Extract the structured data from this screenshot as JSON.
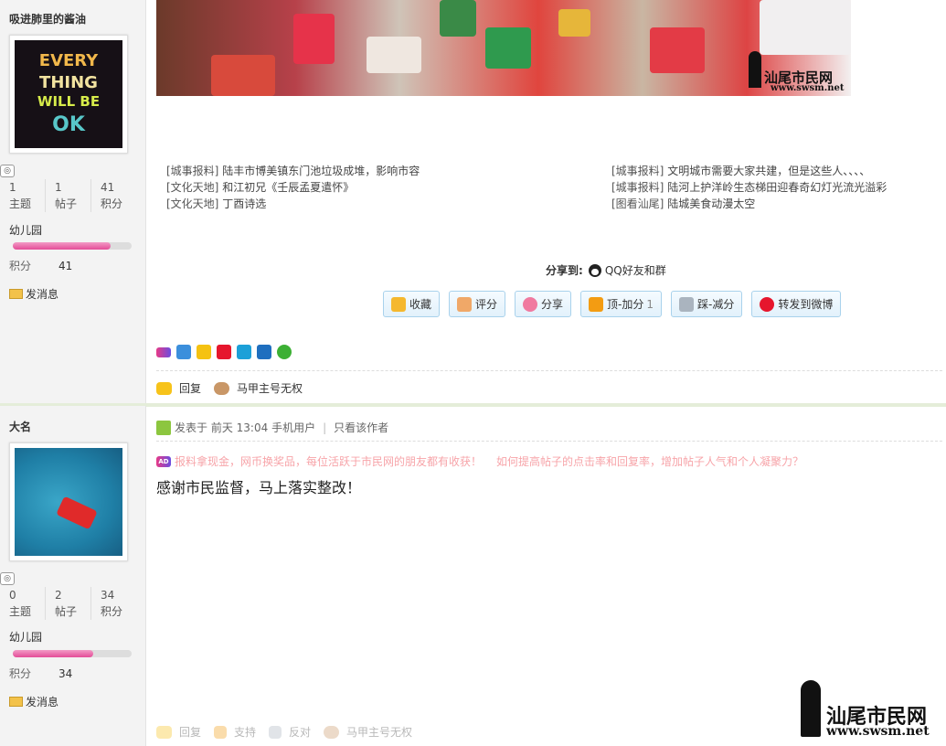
{
  "posts": [
    {
      "author": "吸进肺里的酱油",
      "avatar_text": [
        "EVERY",
        "THING",
        "WILL BE",
        "OK"
      ],
      "stats": [
        {
          "value": "1",
          "label": "主题"
        },
        {
          "value": "1",
          "label": "帖子"
        },
        {
          "value": "41",
          "label": "积分"
        }
      ],
      "level": "幼儿园",
      "level_progress": 0.82,
      "points_label": "积分",
      "points_value": "41",
      "message_label": "发消息"
    },
    {
      "author": "大名",
      "stats": [
        {
          "value": "0",
          "label": "主题"
        },
        {
          "value": "2",
          "label": "帖子"
        },
        {
          "value": "34",
          "label": "积分"
        }
      ],
      "level": "幼儿园",
      "level_progress": 0.68,
      "points_label": "积分",
      "points_value": "34",
      "message_label": "发消息"
    }
  ],
  "banner": {
    "watermark_cn": "汕尾市民网",
    "watermark_url": "www.swsm.net"
  },
  "related_links": {
    "left": [
      {
        "cat": "[城事报料]",
        "title": "陆丰市博美镇东门池垃圾成堆，影响市容"
      },
      {
        "cat": "[文化天地]",
        "title": "和江初兄《壬辰孟夏遣怀》"
      },
      {
        "cat": "[文化天地]",
        "title": "丁酉诗选"
      }
    ],
    "right": [
      {
        "cat": "[城事报料]",
        "title": "文明城市需要大家共建，但是这些人、、、、"
      },
      {
        "cat": "[城事报料]",
        "title": "陆河上护洋岭生态梯田迎春奇幻灯光流光溢彩"
      },
      {
        "cat": "[图看汕尾]",
        "title": "陆城美食动漫太空"
      }
    ]
  },
  "share": {
    "label": "分享到:",
    "target": "QQ好友和群"
  },
  "actions": [
    {
      "label": "收藏",
      "icon": "star-icon",
      "color": "#f5b82e"
    },
    {
      "label": "评分",
      "icon": "thumb-icon",
      "color": "#f0a868"
    },
    {
      "label": "分享",
      "icon": "heart-icon",
      "color": "#f07aa0"
    },
    {
      "label": "顶-加分",
      "count": "1",
      "icon": "arrow-up-icon",
      "color": "#f39c12"
    },
    {
      "label": "踩-减分",
      "icon": "arrow-down-icon",
      "color": "#aab4bf"
    },
    {
      "label": "转发到微博",
      "icon": "weibo-icon",
      "color": "#e6162d"
    }
  ],
  "share_icons": [
    {
      "name": "ad-icon",
      "color": "#7b4ce0"
    },
    {
      "name": "plus-share-icon",
      "color": "#3b8fdc"
    },
    {
      "name": "qzone-icon",
      "color": "#f5c211"
    },
    {
      "name": "weibo-share-icon",
      "color": "#e6162d"
    },
    {
      "name": "tencent-weibo-icon",
      "color": "#1ca0d8"
    },
    {
      "name": "renren-icon",
      "color": "#1f6fbf"
    },
    {
      "name": "wechat-icon",
      "color": "#3cb034"
    }
  ],
  "reply_bar": {
    "reply": "回复",
    "sockpuppet": "马甲主号无权"
  },
  "post2": {
    "posted_prefix": "发表于",
    "posted_time": "前天 13:04",
    "device": "手机用户",
    "only_author": "只看该作者",
    "ad1": "报料拿现金，网币换奖品，每位活跃于市民网的朋友都有收获！",
    "ad2": "如何提高帖子的点击率和回复率，增加帖子人气和个人凝聚力？",
    "content": "感谢市民监督，马上落实整改！",
    "footer": {
      "reply": "回复",
      "support": "支持",
      "oppose": "反对",
      "sockpuppet": "马甲主号无权"
    }
  }
}
